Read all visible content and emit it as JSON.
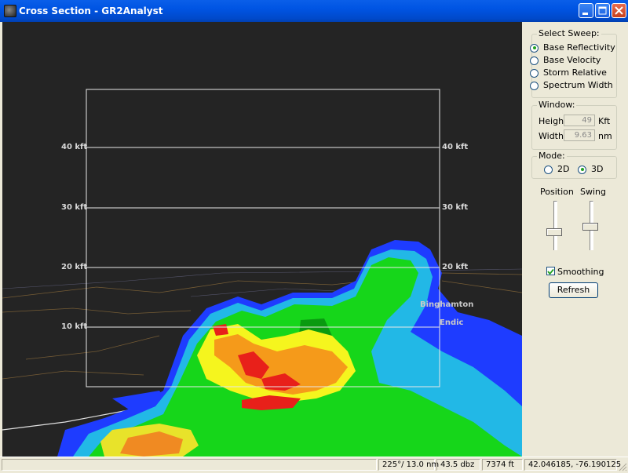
{
  "window": {
    "title": "Cross Section - GR2Analyst"
  },
  "radar": {
    "altitude_labels": [
      "40 kft",
      "30 kft",
      "20 kft",
      "10 kft"
    ],
    "city_label": "Binghamton",
    "city_label2": "Endic"
  },
  "panel": {
    "sweep": {
      "title": "Select Sweep:",
      "options": [
        {
          "label": "Base Reflectivity",
          "selected": true
        },
        {
          "label": "Base Velocity",
          "selected": false
        },
        {
          "label": "Storm Relative",
          "selected": false
        },
        {
          "label": "Spectrum Width",
          "selected": false
        }
      ]
    },
    "window_group": {
      "title": "Window:",
      "height_label": "Height:",
      "height_value": "49",
      "height_unit": "Kft",
      "width_label": "Width:",
      "width_value": "9.63",
      "width_unit": "nm"
    },
    "mode": {
      "title": "Mode:",
      "options": [
        {
          "label": "2D",
          "selected": false
        },
        {
          "label": "3D",
          "selected": true
        }
      ]
    },
    "position_label": "Position",
    "swing_label": "Swing",
    "smoothing_label": "Smoothing",
    "smoothing_checked": true,
    "refresh_label": "Refresh"
  },
  "status": {
    "azimuth_range": "225°/ 13.0 nm",
    "value": "43.5 dbz",
    "altitude": "7374 ft",
    "coords": "42.046185, -76.190125"
  }
}
